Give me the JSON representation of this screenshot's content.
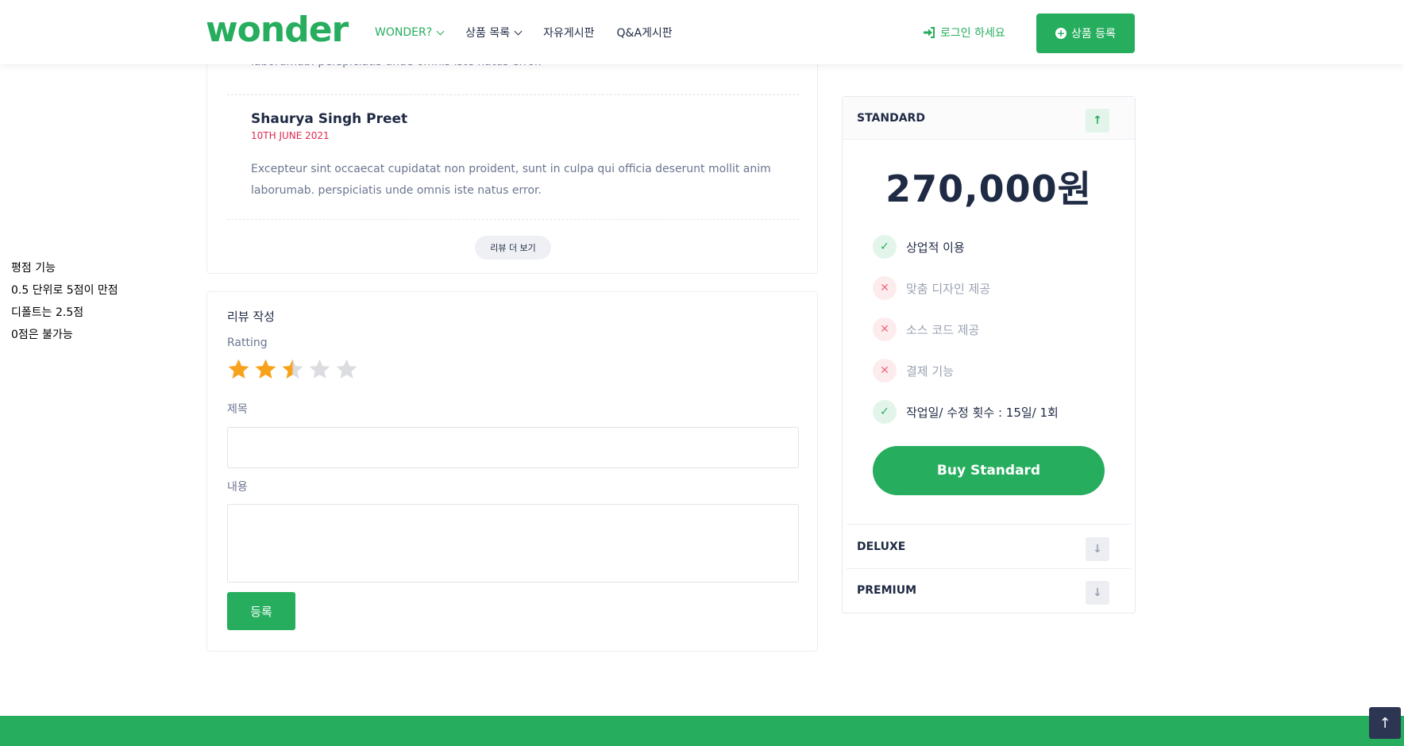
{
  "header": {
    "logo": "wonder",
    "nav": [
      {
        "label": "WONDER?",
        "has_dropdown": true,
        "active": true
      },
      {
        "label": "상품 목록",
        "has_dropdown": true,
        "active": false
      },
      {
        "label": "자유게시판",
        "has_dropdown": false,
        "active": false
      },
      {
        "label": "Q&A게시판",
        "has_dropdown": false,
        "active": false
      }
    ],
    "login_label": "로그인 하세요",
    "register_label": "상품 등록"
  },
  "side_note": {
    "lines": [
      "평점 기능",
      "0.5 단위로 5점이 만점",
      "디폴트는 2.5점",
      "0점은 불가능"
    ]
  },
  "reviews": {
    "partial_text": "laborumab. perspiciatis unde omnis iste natus error.",
    "items": [
      {
        "name": "Shaurya Singh Preet",
        "date": "10TH JUNE 2021",
        "text": "Excepteur sint occaecat cupidatat non proident, sunt in culpa qui officia deserunt mollit anim laborumab. perspiciatis unde omnis iste natus error."
      }
    ],
    "more_label": "리뷰 더 보기"
  },
  "review_form": {
    "title": "리뷰 작성",
    "rating_label": "Ratting",
    "rating_value": 2.5,
    "rating_max": 5,
    "title_label": "제목",
    "title_value": "",
    "content_label": "내용",
    "content_value": "",
    "submit_label": "등록"
  },
  "pricing": {
    "packages": [
      {
        "name": "STANDARD",
        "expanded": true
      },
      {
        "name": "DELUXE",
        "expanded": false
      },
      {
        "name": "PREMIUM",
        "expanded": false
      }
    ],
    "price": "270,000원",
    "features": [
      {
        "label": "상업적 이용",
        "included": true
      },
      {
        "label": "맞춤 디자인 제공",
        "included": false
      },
      {
        "label": "소스 코드 제공",
        "included": false
      },
      {
        "label": "결제 기능",
        "included": false
      },
      {
        "label": "작업일/ 수정 횟수 : 15일/ 1회",
        "included": true
      }
    ],
    "buy_label": "Buy Standard"
  },
  "colors": {
    "brand": "#26ad5e",
    "dark": "#1f2a44",
    "muted": "#6b7590",
    "danger": "#e0284f",
    "star": "#f8a11b"
  },
  "icons": {
    "login": "sign-in-icon",
    "register": "plus-circle-icon",
    "back_to_top": "arrow-up-icon"
  }
}
